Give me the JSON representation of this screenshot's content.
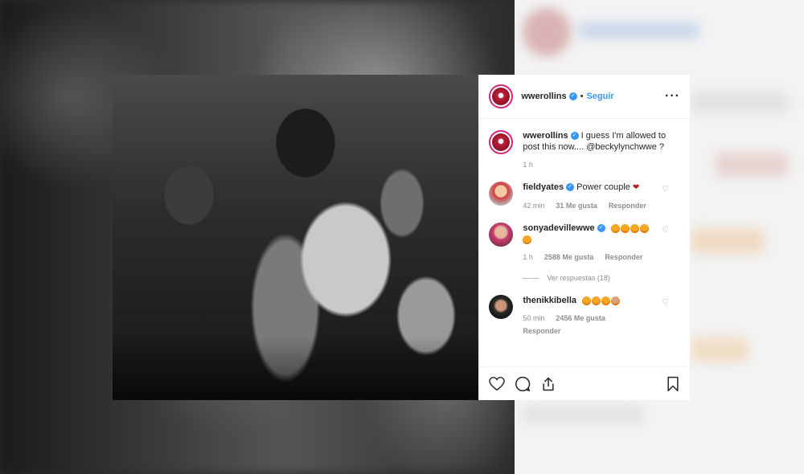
{
  "post": {
    "username": "wwerollins",
    "follow_label": "Seguir",
    "separator": "•",
    "caption": {
      "username": "wwerollins",
      "text": "I guess I'm allowed to post this now.... @beckylynchwwe ?",
      "time": "1 h"
    }
  },
  "comments": [
    {
      "username": "fieldyates",
      "text": "Power couple",
      "time": "42 min",
      "likes": "31 Me gusta",
      "reply": "Responder",
      "emoji_count": 1
    },
    {
      "username": "sonyadevillewwe",
      "text": "",
      "time": "1 h",
      "likes": "2588 Me gusta",
      "reply": "Responder",
      "emoji_count": 5,
      "view_replies": "Ver respuestas (18)"
    },
    {
      "username": "thenikkibella",
      "text": "",
      "time": "50 min",
      "likes": "2456 Me gusta",
      "reply": "Responder",
      "emoji_count": 4
    }
  ],
  "icons": [
    "heart-icon",
    "comment-icon",
    "share-icon",
    "bookmark-icon",
    "more-options-icon",
    "verified-icon"
  ],
  "colors": {
    "link": "#3897f0",
    "text": "#262626",
    "muted": "#8e8e8e",
    "border": "#efefef",
    "avatar_ring": "#d6247a"
  }
}
